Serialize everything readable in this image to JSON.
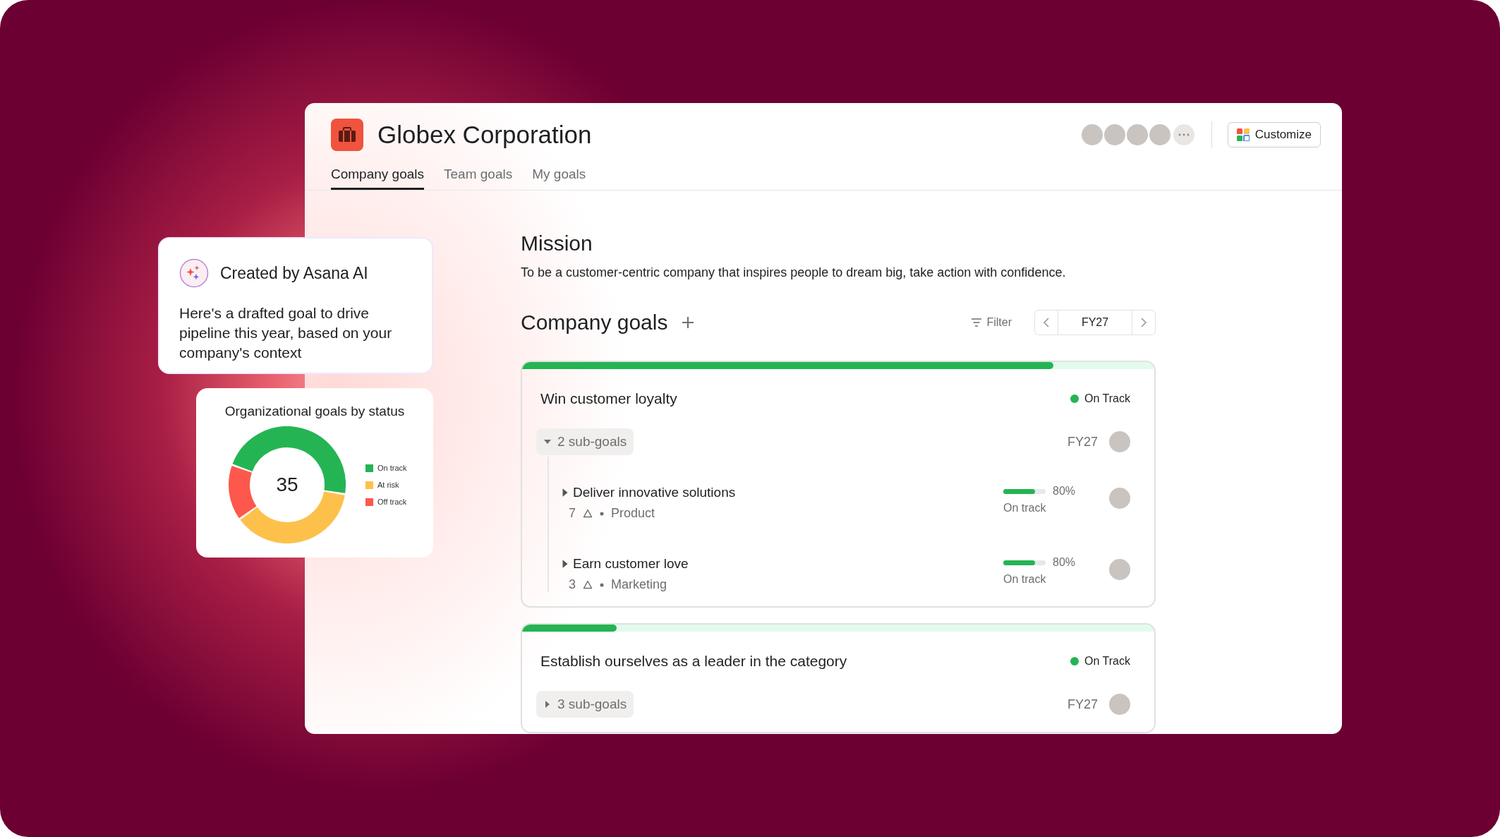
{
  "app": {
    "title": "Globex Corporation",
    "customize": "Customize"
  },
  "tabs": [
    {
      "label": "Company goals",
      "selected": true
    },
    {
      "label": "Team goals",
      "selected": false
    },
    {
      "label": "My goals",
      "selected": false
    }
  ],
  "mission": {
    "heading": "Mission",
    "text": "To be a customer-centric company that inspires people to dream big, take action with confidence."
  },
  "goals_section": {
    "heading": "Company goals",
    "filter": "Filter",
    "period": "FY27"
  },
  "goals": [
    {
      "title": "Win customer loyalty",
      "level": 0.84,
      "status": {
        "label": "On Track",
        "color": "#25b454"
      },
      "subgoals": {
        "label": "2 sub-goals",
        "expanded": true
      },
      "period": "FY27",
      "children": [
        {
          "title": "Deliver innovative solutions",
          "expanded": false,
          "count": "7",
          "team": "Product",
          "level": 0.75,
          "percent": "80%",
          "status": "On track"
        },
        {
          "title": "Earn customer love",
          "expanded": false,
          "count": "3",
          "team": "Marketing",
          "level": 0.75,
          "percent": "80%",
          "status": "On track"
        }
      ]
    },
    {
      "title": "Establish ourselves as a leader in the category",
      "level": 0.15,
      "status": {
        "label": "On Track",
        "color": "#25b454"
      },
      "subgoals": {
        "label": "3 sub-goals",
        "expanded": false
      },
      "period": "FY27"
    }
  ],
  "ai_card": {
    "title": "Created by Asana AI",
    "text": "Here's a drafted goal to drive pipeline this year, based on your company's context"
  },
  "status_chart": {
    "title": "Organizational goals by status",
    "total": "35",
    "legend": [
      {
        "label": "On track",
        "color": "#25b454"
      },
      {
        "label": "At risk",
        "color": "#fdc14b"
      },
      {
        "label": "Off track",
        "color": "#fd584b"
      }
    ]
  }
}
